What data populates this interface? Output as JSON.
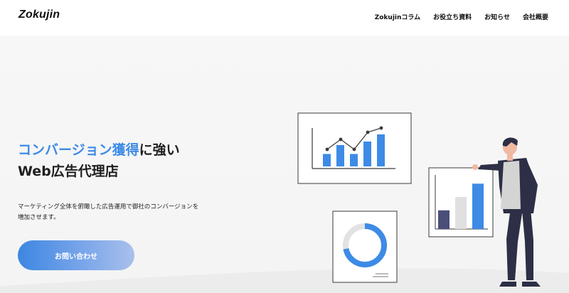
{
  "brand": {
    "logo_text": "Zokujin"
  },
  "nav": {
    "items": [
      {
        "label": "Zokujinコラム"
      },
      {
        "label": "お役立ち資料"
      },
      {
        "label": "お知らせ"
      },
      {
        "label": "会社概要"
      }
    ]
  },
  "hero": {
    "headline_accent": "コンバージョン獲得",
    "headline_rest": "に強い",
    "headline_line2": "Web広告代理店",
    "description_line1": "マーケティング全体を俯瞰した広告運用で御社のコンバージョンを",
    "description_line2": "増加させます。",
    "cta_label": "お問い合わせ"
  },
  "colors": {
    "accent": "#3d8be6",
    "dark_bar": "#4a4f7a",
    "light_bar": "#e0e0e0",
    "figure_dark": "#2c2f45"
  },
  "illustration": {
    "main_chart_bars": [
      0.35,
      0.6,
      0.35,
      0.7,
      0.9
    ],
    "side_chart_bars": [
      0.35,
      0.6,
      0.85
    ],
    "donut_fraction": 0.72
  }
}
